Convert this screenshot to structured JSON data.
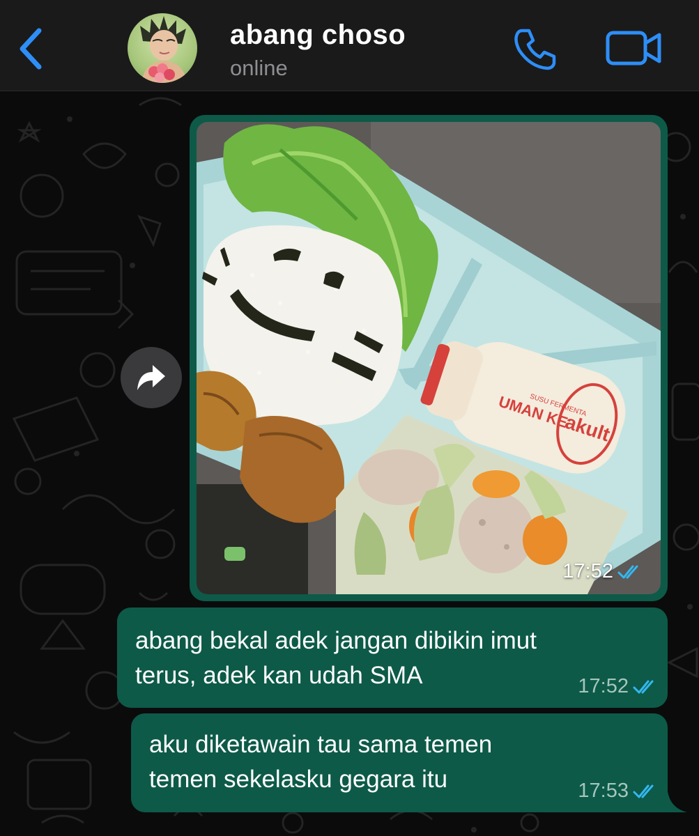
{
  "header": {
    "contact_name": "abang choso",
    "status": "online",
    "back_icon": "chevron-left-icon",
    "call_icon": "phone-icon",
    "video_icon": "video-camera-icon",
    "accent_color": "#2e8ef7"
  },
  "chat": {
    "forward_icon": "forward-arrow-icon",
    "image_message": {
      "time": "17:52",
      "status_icon": "double-check-icon",
      "photo_text": {
        "bottle_brand": "akult",
        "bottle_side": "UMAN KE",
        "bottle_small": "SUSU FERMENTA"
      }
    },
    "messages": [
      {
        "text": "abang bekal adek jangan dibikin imut\nterus, adek kan udah SMA",
        "time": "17:52",
        "status_icon": "double-check-icon"
      },
      {
        "text": "aku diketawain tau sama temen\ntemen sekelasku gegara itu",
        "time": "17:53",
        "status_icon": "double-check-icon"
      }
    ],
    "bubble_color": "#0d5a48",
    "tick_color": "#34b7f1"
  }
}
